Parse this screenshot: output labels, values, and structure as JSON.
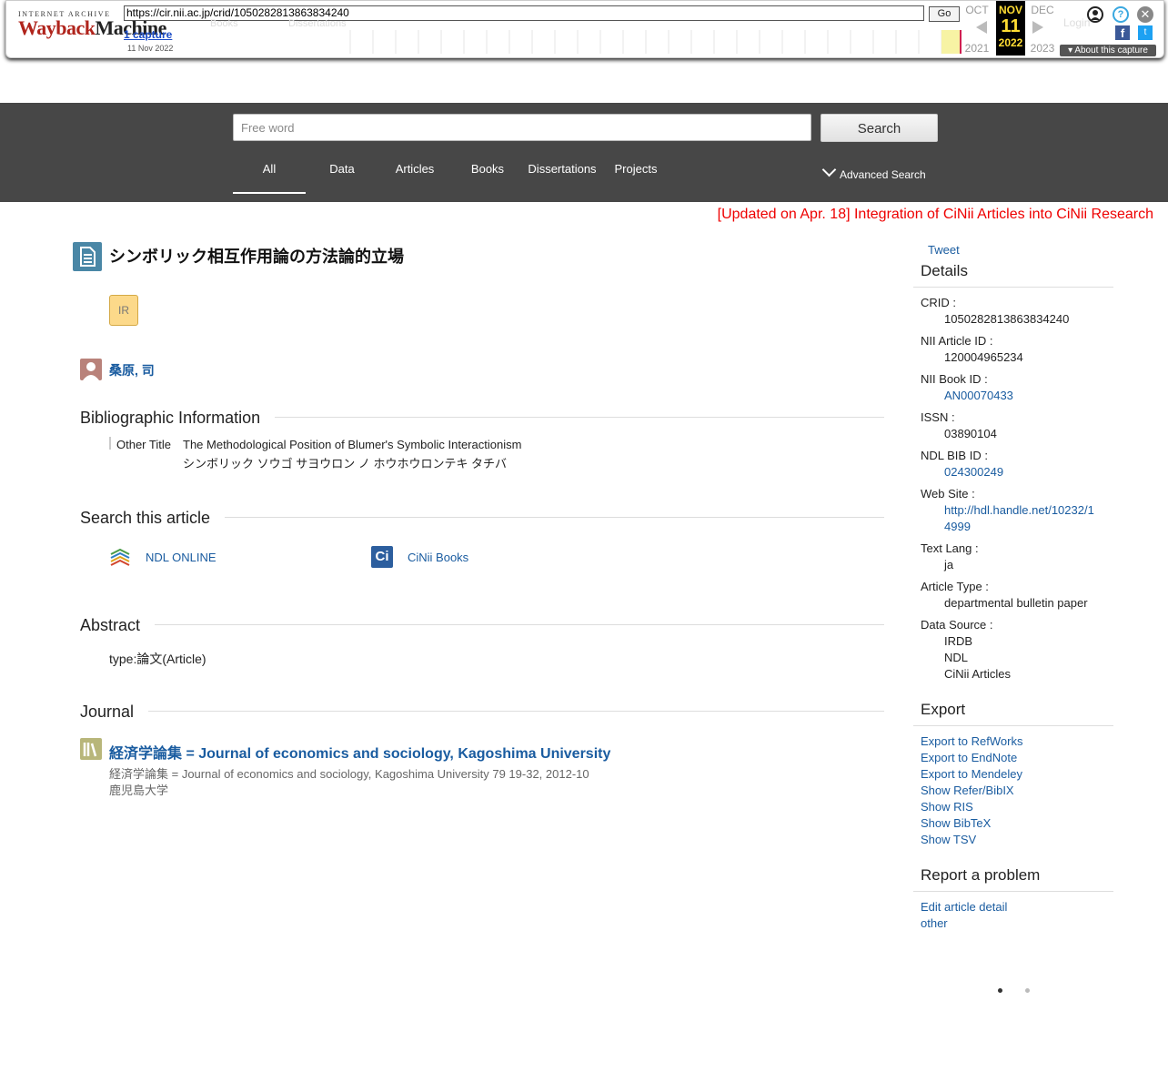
{
  "wayback": {
    "logo_top": "INTERNET ARCHIVE",
    "logo_main_a": "Wayback",
    "logo_main_b": "Machine",
    "url": "https://cir.nii.ac.jp/crid/1050282813863834240",
    "go_label": "Go",
    "captures_label": "1 capture",
    "capture_date": "11 Nov 2022",
    "ghost_books": "Books",
    "ghost_dissertations": "Dissertations",
    "ghost_login": "Login",
    "prev_month": "OCT",
    "prev_year": "2021",
    "cur_month": "NOV",
    "cur_day": "11",
    "cur_year": "2022",
    "next_month": "DEC",
    "next_year": "2023",
    "about_label": "About this capture",
    "colors": {
      "highlight": "#ffdd33",
      "bar_active": "#f7f3a4"
    }
  },
  "search": {
    "placeholder": "Free word",
    "button": "Search",
    "tabs": [
      "All",
      "Data",
      "Articles",
      "Books",
      "Dissertations",
      "Projects"
    ],
    "active_tab": "All",
    "advanced": "Advanced Search"
  },
  "notice": "[Updated on Apr. 18] Integration of CiNii Articles into CiNii Research",
  "article": {
    "title": "シンボリック相互作用論の方法論的立場",
    "badge": "IR",
    "author": "桑原, 司"
  },
  "bibliographic": {
    "heading": "Bibliographic Information",
    "other_title_label": "Other Title",
    "other_title_values": [
      "The Methodological Position of Blumer's Symbolic Interactionism",
      "シンボリック ソウゴ サヨウロン ノ ホウホウロンテキ タチバ"
    ]
  },
  "search_article": {
    "heading": "Search this article",
    "links": [
      "NDL ONLINE",
      "CiNii Books"
    ]
  },
  "abstract": {
    "heading": "Abstract",
    "text": "type:論文(Article)"
  },
  "journal": {
    "heading": "Journal",
    "title": "経済学論集 = Journal of economics and sociology, Kagoshima University",
    "line1": "経済学論集 = Journal of economics and sociology, Kagoshima University 79 19-32, 2012-10",
    "line2": "鹿児島大学"
  },
  "sidebar": {
    "tweet": "Tweet",
    "details_heading": "Details",
    "crid_label": "CRID :",
    "crid": "1050282813863834240",
    "nii_article_label": "NII Article ID :",
    "nii_article": "120004965234",
    "nii_book_label": "NII Book ID :",
    "nii_book": "AN00070433",
    "issn_label": "ISSN :",
    "issn": "03890104",
    "ndl_bib_label": "NDL BIB ID :",
    "ndl_bib": "024300249",
    "website_label": "Web Site :",
    "website_line1": "http://hdl.handle.net/10232/1",
    "website_line2": "4999",
    "lang_label": "Text Lang :",
    "lang": "ja",
    "type_label": "Article Type :",
    "type": "departmental bulletin paper",
    "source_label": "Data Source :",
    "sources": [
      "IRDB",
      "NDL",
      "CiNii Articles"
    ],
    "export_heading": "Export",
    "export_links": [
      "Export to RefWorks",
      "Export to EndNote",
      "Export to Mendeley",
      "Show Refer/BibIX",
      "Show RIS",
      "Show BibTeX",
      "Show TSV"
    ],
    "report_heading": "Report a problem",
    "report_links": [
      "Edit article detail",
      "other"
    ]
  }
}
